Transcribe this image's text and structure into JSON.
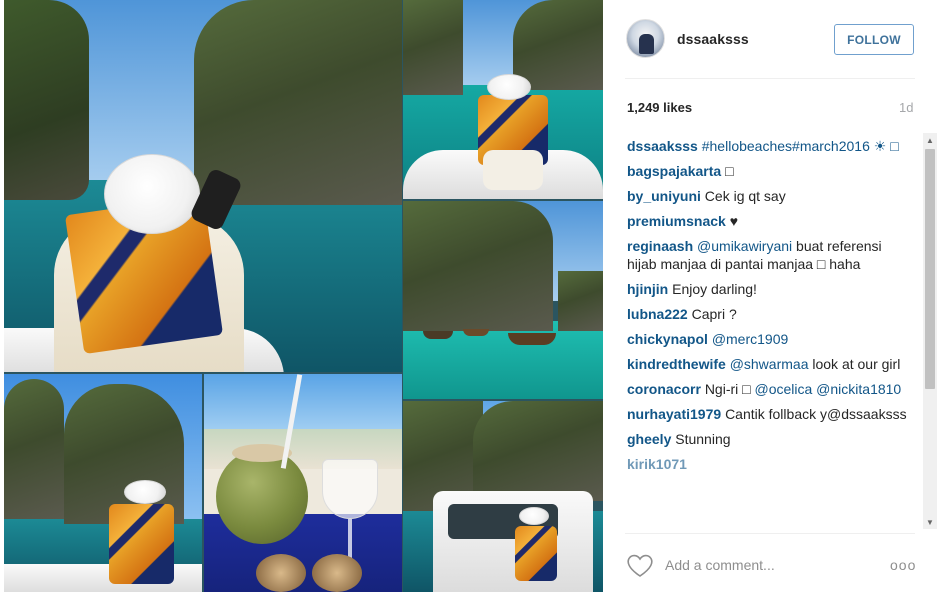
{
  "post": {
    "username": "dssaaksss",
    "follow_label": "FOLLOW",
    "likes": "1,249 likes",
    "age": "1d"
  },
  "comments": [
    {
      "user": "dssaaksss",
      "text": "#hellobeaches#march2016 ☀ □",
      "mentions": ""
    },
    {
      "user": "bagspajakarta",
      "text": "□",
      "mentions": ""
    },
    {
      "user": "by_uniyuni",
      "text": "Cek ig qt say",
      "mentions": ""
    },
    {
      "user": "premiumsnack",
      "text": "♥",
      "mentions": ""
    },
    {
      "user": "reginaash",
      "mentions": "@umikawiryani",
      "text": "buat referensi hijab manjaa di pantai manjaa □ haha"
    },
    {
      "user": "hjinjin",
      "text": "Enjoy darling!",
      "mentions": ""
    },
    {
      "user": "lubna222",
      "text": "Capri ?",
      "mentions": ""
    },
    {
      "user": "chickynapol",
      "mentions": "@merc1909",
      "text": ""
    },
    {
      "user": "kindredthewife",
      "mentions": "@shwarmaa",
      "text": "look at our girl"
    },
    {
      "user": "coronacorr",
      "text": "Ngi-ri □",
      "mentions": "@ocelica @nickita1810"
    },
    {
      "user": "nurhayati1979",
      "text": "Cantik follback y@dssaaksss",
      "mentions": ""
    },
    {
      "user": "gheely",
      "text": "Stunning",
      "mentions": ""
    },
    {
      "user": "kirik1071",
      "text": "",
      "mentions": ""
    }
  ],
  "footer": {
    "add_comment_placeholder": "Add a comment...",
    "more_label": "ooo"
  },
  "icons": {
    "heart": "heart-outline-icon",
    "more": "more-options-icon",
    "scroll_up": "scroll-up-arrow-icon",
    "scroll_down": "scroll-down-arrow-icon"
  },
  "colors": {
    "link": "#125688",
    "follow_border": "#70a0ce",
    "follow_text": "#3f729b",
    "muted": "#a5a7aa"
  }
}
